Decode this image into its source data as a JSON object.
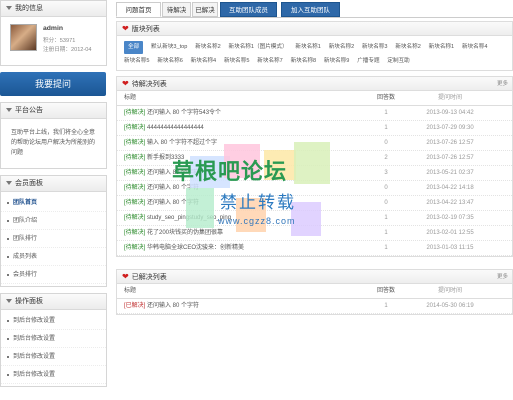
{
  "sidebar": {
    "my_info_title": "我的信息",
    "username": "admin",
    "points": "积分：53971",
    "register_date": "注册日期：2012-04",
    "ask_button": "我要提问",
    "notice_title": "平台公告",
    "notice_text": "互助平台上线，我们将全心全意的帮助论坛用户解决为所能别的问题",
    "member_panel_title": "会员面板",
    "member_menu": [
      "团队首页",
      "团队介绍",
      "团队排行",
      "成员列表",
      "会员排行"
    ],
    "ops_panel_title": "操作面板",
    "ops_menu": [
      "到后台修改设置",
      "到后台修改设置",
      "到后台修改设置",
      "到后台修改设置"
    ]
  },
  "tabs": [
    "问题首页",
    "待解决",
    "已解决",
    "互助团队成员",
    "加入互助团队"
  ],
  "section_title": "版块列表",
  "categories": [
    "全部",
    "默认新块3_top",
    "新块名称2",
    "新块名称1（图片模式）",
    "新块名称1",
    "新块名称2",
    "新块名称3",
    "新块名称2",
    "新块名称1",
    "新块名称4",
    "新块名称5",
    "新块名称6",
    "新块名称4",
    "新块名称5",
    "新块名称7",
    "新块名称8",
    "新块名称9",
    "广播专题",
    "定制互助"
  ],
  "pending": {
    "title": "待解决列表",
    "more": "更多",
    "headers": {
      "title": "标题",
      "answers": "回答数",
      "time": "提问时间"
    },
    "rows": [
      {
        "tag": "[待解决]",
        "text": " 还问输入 80 个字符543令个",
        "answers": "1",
        "time": "2013-09-13 04:42"
      },
      {
        "tag": "[待解决]",
        "text": " 44444444444444444",
        "answers": "1",
        "time": "2013-07-29 09:30"
      },
      {
        "tag": "[待解决]",
        "text": " 输入 80 个字符不超过个字",
        "answers": "0",
        "time": "2013-07-26 12:57"
      },
      {
        "tag": "[待解决]",
        "text": " 新手报到3333",
        "answers": "2",
        "time": "2013-07-26 12:57"
      },
      {
        "tag": "[待解决]",
        "text": " 还问输入 80 个字符",
        "answers": "3",
        "time": "2013-05-21 02:37"
      },
      {
        "tag": "[待解决]",
        "text": " 还问输入 80 个字符",
        "answers": "0",
        "time": "2013-04-22 14:18"
      },
      {
        "tag": "[待解决]",
        "text": " 还问输入 80 个字符",
        "answers": "0",
        "time": "2013-04-22 13:47"
      },
      {
        "tag": "[待解决]",
        "text": " study_seo_pingstudy_seo_ping",
        "answers": "1",
        "time": "2013-02-19 07:35"
      },
      {
        "tag": "[待解决]",
        "text": " 花了200块钱买的伪集团很靠",
        "answers": "1",
        "time": "2013-02-01 12:55"
      },
      {
        "tag": "[待解决]",
        "text": " 华韩电脑全球CEO沈骏来：创新精美",
        "answers": "1",
        "time": "2013-01-03 11:15"
      }
    ]
  },
  "solved": {
    "title": "已解决列表",
    "more": "更多",
    "headers": {
      "title": "标题",
      "answers": "回答数",
      "time": "提问时间"
    },
    "rows": [
      {
        "tag": "[已解决]",
        "text": " 还问输入 80 个字符",
        "answers": "1",
        "time": "2014-05-30 06:19"
      }
    ]
  },
  "watermark": {
    "line1": "草根吧论坛",
    "line2": "禁止转载",
    "line3": "www.cgzz8.com"
  },
  "colors": {
    "accent": "#2e68a8",
    "pending_tag": "#2a8a2a",
    "solved_tag": "#c03030",
    "heart": "#d02020"
  }
}
